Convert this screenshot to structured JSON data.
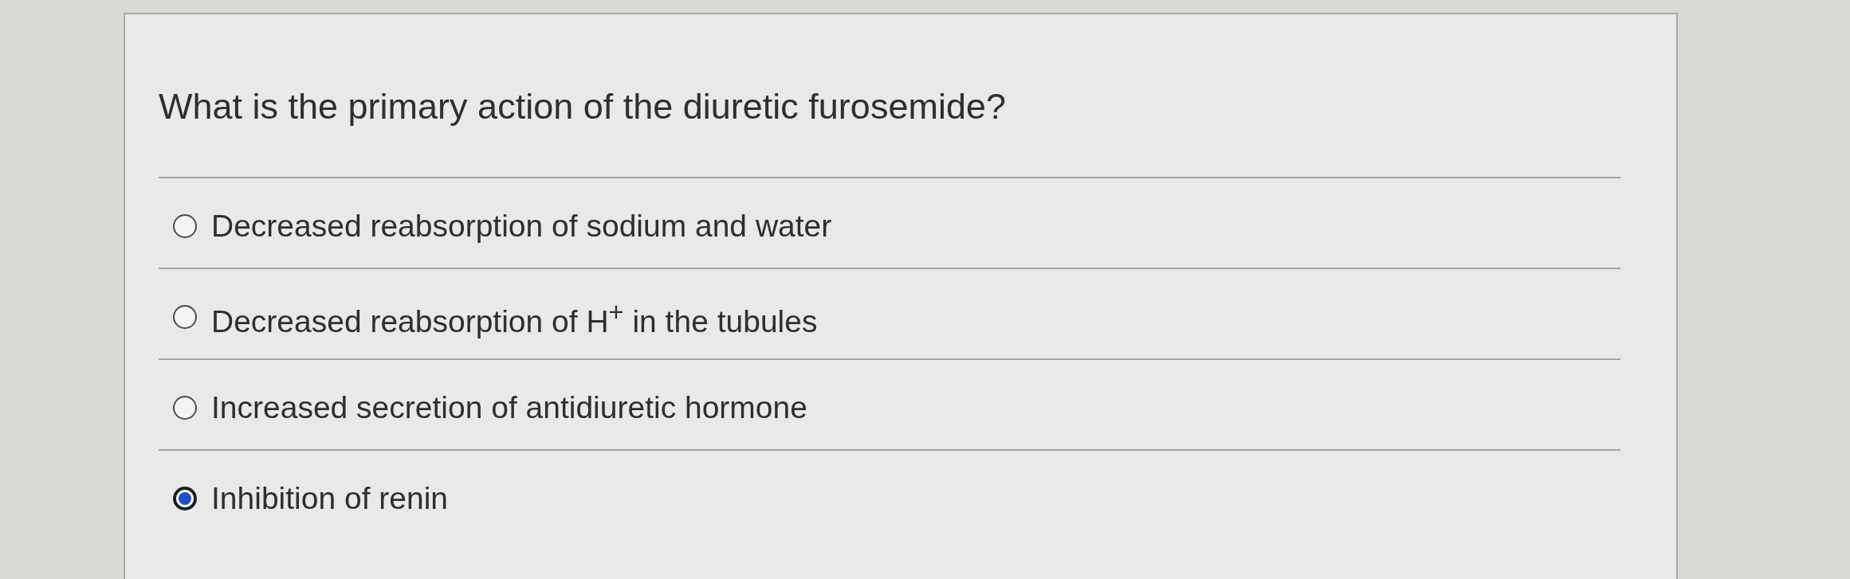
{
  "question": {
    "text": "What is the primary action of the diuretic furosemide?"
  },
  "options": [
    {
      "label": "Decreased reabsorption of sodium and water",
      "selected": false
    },
    {
      "label": "Decreased reabsorption of H$^{+}$ in the tubules",
      "selected": false
    },
    {
      "label": "Increased secretion of antidiuretic hormone",
      "selected": false
    },
    {
      "label": "Inhibition of renin",
      "selected": true
    }
  ]
}
